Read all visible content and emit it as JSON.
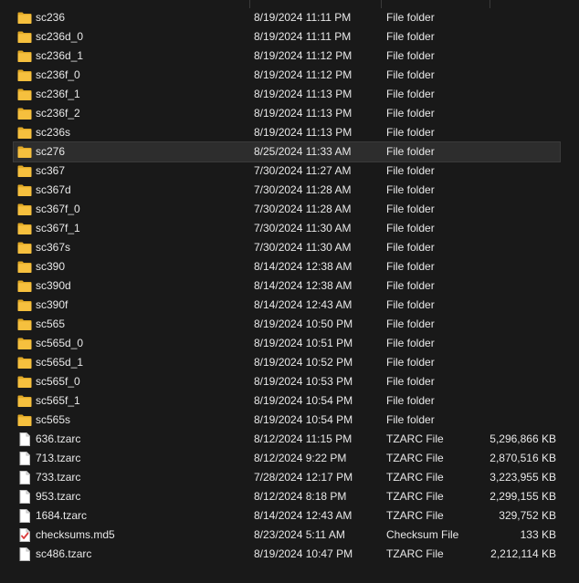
{
  "colors": {
    "background": "#191919",
    "text": "#e8e8e8",
    "folder": "#f6c03e",
    "folder_dark": "#e0a825",
    "selected_row": "#2d2d2d",
    "checksum_mark": "#d93a3a"
  },
  "selected_row": 7,
  "rows": [
    {
      "name": "sc236",
      "date": "8/19/2024 11:11 PM",
      "type": "File folder",
      "size": "",
      "icon": "folder-icon"
    },
    {
      "name": "sc236d_0",
      "date": "8/19/2024 11:11 PM",
      "type": "File folder",
      "size": "",
      "icon": "folder-icon"
    },
    {
      "name": "sc236d_1",
      "date": "8/19/2024 11:12 PM",
      "type": "File folder",
      "size": "",
      "icon": "folder-icon"
    },
    {
      "name": "sc236f_0",
      "date": "8/19/2024 11:12 PM",
      "type": "File folder",
      "size": "",
      "icon": "folder-icon"
    },
    {
      "name": "sc236f_1",
      "date": "8/19/2024 11:13 PM",
      "type": "File folder",
      "size": "",
      "icon": "folder-icon"
    },
    {
      "name": "sc236f_2",
      "date": "8/19/2024 11:13 PM",
      "type": "File folder",
      "size": "",
      "icon": "folder-icon"
    },
    {
      "name": "sc236s",
      "date": "8/19/2024 11:13 PM",
      "type": "File folder",
      "size": "",
      "icon": "folder-icon"
    },
    {
      "name": "sc276",
      "date": "8/25/2024 11:33 AM",
      "type": "File folder",
      "size": "",
      "icon": "folder-icon"
    },
    {
      "name": "sc367",
      "date": "7/30/2024 11:27 AM",
      "type": "File folder",
      "size": "",
      "icon": "folder-icon"
    },
    {
      "name": "sc367d",
      "date": "7/30/2024 11:28 AM",
      "type": "File folder",
      "size": "",
      "icon": "folder-icon"
    },
    {
      "name": "sc367f_0",
      "date": "7/30/2024 11:28 AM",
      "type": "File folder",
      "size": "",
      "icon": "folder-icon"
    },
    {
      "name": "sc367f_1",
      "date": "7/30/2024 11:30 AM",
      "type": "File folder",
      "size": "",
      "icon": "folder-icon"
    },
    {
      "name": "sc367s",
      "date": "7/30/2024 11:30 AM",
      "type": "File folder",
      "size": "",
      "icon": "folder-icon"
    },
    {
      "name": "sc390",
      "date": "8/14/2024 12:38 AM",
      "type": "File folder",
      "size": "",
      "icon": "folder-icon"
    },
    {
      "name": "sc390d",
      "date": "8/14/2024 12:38 AM",
      "type": "File folder",
      "size": "",
      "icon": "folder-icon"
    },
    {
      "name": "sc390f",
      "date": "8/14/2024 12:43 AM",
      "type": "File folder",
      "size": "",
      "icon": "folder-icon"
    },
    {
      "name": "sc565",
      "date": "8/19/2024 10:50 PM",
      "type": "File folder",
      "size": "",
      "icon": "folder-icon"
    },
    {
      "name": "sc565d_0",
      "date": "8/19/2024 10:51 PM",
      "type": "File folder",
      "size": "",
      "icon": "folder-icon"
    },
    {
      "name": "sc565d_1",
      "date": "8/19/2024 10:52 PM",
      "type": "File folder",
      "size": "",
      "icon": "folder-icon"
    },
    {
      "name": "sc565f_0",
      "date": "8/19/2024 10:53 PM",
      "type": "File folder",
      "size": "",
      "icon": "folder-icon"
    },
    {
      "name": "sc565f_1",
      "date": "8/19/2024 10:54 PM",
      "type": "File folder",
      "size": "",
      "icon": "folder-icon"
    },
    {
      "name": "sc565s",
      "date": "8/19/2024 10:54 PM",
      "type": "File folder",
      "size": "",
      "icon": "folder-icon"
    },
    {
      "name": "636.tzarc",
      "date": "8/12/2024 11:15 PM",
      "type": "TZARC File",
      "size": "5,296,866 KB",
      "icon": "file-icon"
    },
    {
      "name": "713.tzarc",
      "date": "8/12/2024 9:22 PM",
      "type": "TZARC File",
      "size": "2,870,516 KB",
      "icon": "file-icon"
    },
    {
      "name": "733.tzarc",
      "date": "7/28/2024 12:17 PM",
      "type": "TZARC File",
      "size": "3,223,955 KB",
      "icon": "file-icon"
    },
    {
      "name": "953.tzarc",
      "date": "8/12/2024 8:18 PM",
      "type": "TZARC File",
      "size": "2,299,155 KB",
      "icon": "file-icon"
    },
    {
      "name": "1684.tzarc",
      "date": "8/14/2024 12:43 AM",
      "type": "TZARC File",
      "size": "329,752 KB",
      "icon": "file-icon"
    },
    {
      "name": "checksums.md5",
      "date": "8/23/2024 5:11 AM",
      "type": "Checksum File",
      "size": "133 KB",
      "icon": "checksum-file-icon"
    },
    {
      "name": "sc486.tzarc",
      "date": "8/19/2024 10:47 PM",
      "type": "TZARC File",
      "size": "2,212,114 KB",
      "icon": "file-icon"
    }
  ]
}
